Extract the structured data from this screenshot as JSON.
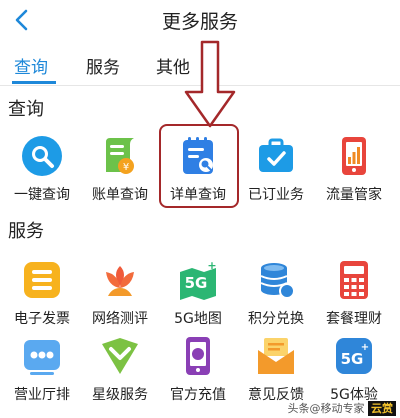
{
  "header": {
    "title": "更多服务"
  },
  "tabs": [
    {
      "label": "查询",
      "active": true
    },
    {
      "label": "服务",
      "active": false
    },
    {
      "label": "其他",
      "active": false
    }
  ],
  "sections": {
    "query": {
      "title": "查询",
      "items": [
        {
          "label": "一键查询",
          "icon": "magnifier-icon"
        },
        {
          "label": "账单查询",
          "icon": "bill-icon"
        },
        {
          "label": "详单查询",
          "icon": "detail-list-icon"
        },
        {
          "label": "已订业务",
          "icon": "briefcase-icon"
        },
        {
          "label": "流量管家",
          "icon": "data-meter-icon"
        }
      ]
    },
    "service": {
      "title": "服务",
      "items": [
        {
          "label": "电子发票",
          "icon": "invoice-icon"
        },
        {
          "label": "网络测评",
          "icon": "flower-icon"
        },
        {
          "label": "5G地图",
          "icon": "5g-map-icon"
        },
        {
          "label": "积分兑换",
          "icon": "coins-icon"
        },
        {
          "label": "套餐理财",
          "icon": "calculator-icon"
        },
        {
          "label": "营业厅排",
          "icon": "queue-icon"
        },
        {
          "label": "星级服务",
          "icon": "chevron-badge-icon"
        },
        {
          "label": "官方充值",
          "icon": "phone-recharge-icon"
        },
        {
          "label": "意见反馈",
          "icon": "feedback-mail-icon"
        },
        {
          "label": "5G体验",
          "icon": "5g-experience-icon"
        }
      ]
    }
  },
  "watermark": {
    "text": "头条@移动专家",
    "brand": "云赏"
  },
  "colors": {
    "accent": "#1e88d9",
    "highlight": "#a4282a"
  }
}
